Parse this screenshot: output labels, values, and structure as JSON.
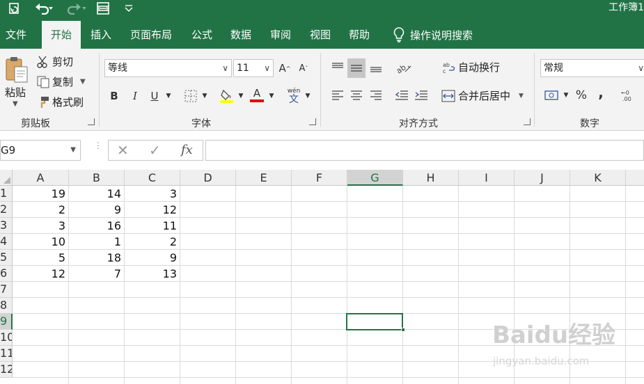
{
  "window": {
    "title": "工作簿1"
  },
  "tabs": [
    "文件",
    "开始",
    "插入",
    "页面布局",
    "公式",
    "数据",
    "审阅",
    "视图",
    "帮助"
  ],
  "tell_me": "操作说明搜索",
  "clipboard": {
    "paste": "粘贴",
    "cut": "剪切",
    "copy": "复制",
    "format_painter": "格式刷",
    "group_label": "剪贴板"
  },
  "font": {
    "name": "等线",
    "size": "11",
    "bold": "B",
    "italic": "I",
    "underline": "U",
    "font_color_letter": "A",
    "phonetic": "wén",
    "phonetic_char": "文",
    "group_label": "字体"
  },
  "alignment": {
    "wrap_text": "自动换行",
    "merge_center": "合并后居中",
    "group_label": "对齐方式"
  },
  "number": {
    "format": "常规",
    "percent": "%",
    "comma": ",",
    "group_label": "数字"
  },
  "formula_bar": {
    "name_box": "G9",
    "fx": "fx",
    "value": ""
  },
  "columns": [
    "A",
    "B",
    "C",
    "D",
    "E",
    "F",
    "G",
    "H",
    "I",
    "J",
    "K"
  ],
  "selected_column": "G",
  "rows": [
    "1",
    "2",
    "3",
    "4",
    "5",
    "6",
    "7",
    "8",
    "9",
    "10",
    "11",
    "12"
  ],
  "selected_row": "9",
  "cells": [
    [
      "19",
      "14",
      "3"
    ],
    [
      "2",
      "9",
      "12"
    ],
    [
      "3",
      "16",
      "11"
    ],
    [
      "10",
      "1",
      "2"
    ],
    [
      "5",
      "18",
      "9"
    ],
    [
      "12",
      "7",
      "13"
    ]
  ],
  "watermark": {
    "brand": "Baidu经验",
    "url": "jingyan.baidu.com"
  },
  "colors": {
    "accent": "#217346",
    "ribbon_bg": "#f3f3f3",
    "grid_line": "#dadada"
  }
}
